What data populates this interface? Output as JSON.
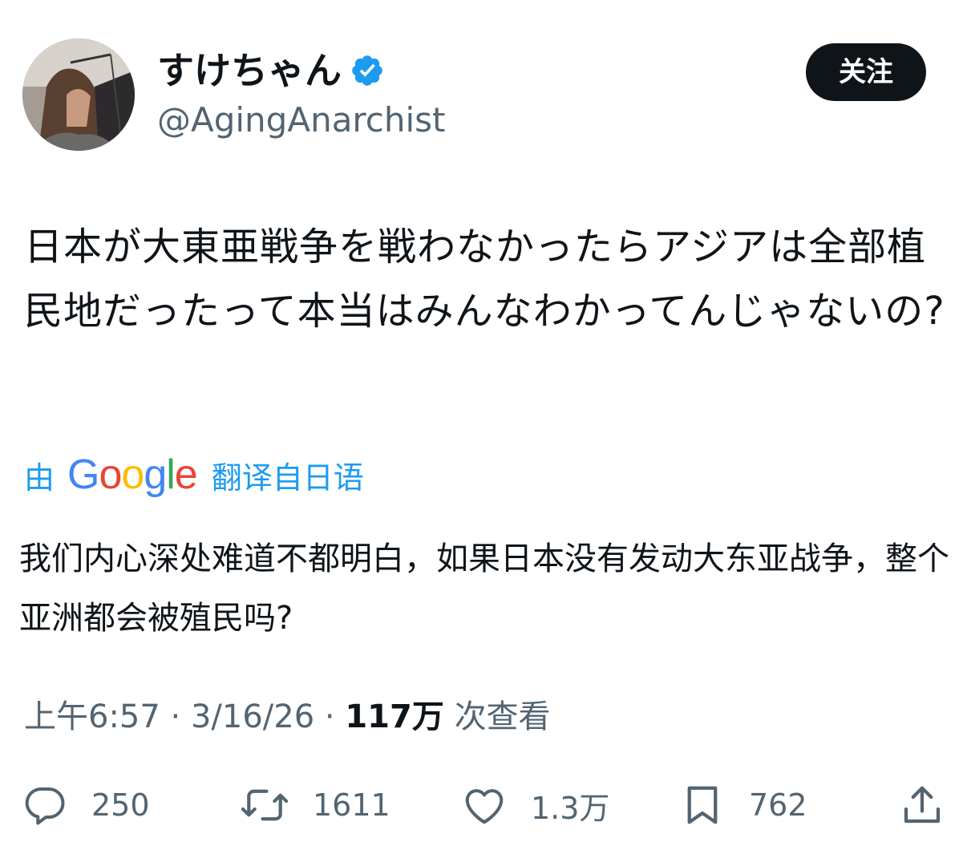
{
  "author": {
    "display_name": "すけちゃん",
    "handle": "@AgingAnarchist",
    "avatar_icon": "avatar-photo",
    "verified_icon": "verified-badge-icon",
    "verified_color": "#1d9bf0"
  },
  "follow_button": {
    "label": "关注"
  },
  "tweet": {
    "text": "日本が大東亜戦争を戦わなかったらアジアは全部植民地だったって本当はみんなわかってんじゃないの?"
  },
  "translation": {
    "prefix": "由",
    "provider": "Google",
    "suffix": "翻译自日语",
    "color": "#1d9bf0",
    "text": "我们内心深处难道不都明白，如果日本没有发动大东亚战争，整个亚洲都会被殖民吗?"
  },
  "meta": {
    "time": "上午6:57",
    "separator": "·",
    "date": "3/16/26",
    "views_count": "117万",
    "views_label": "次查看"
  },
  "actions": {
    "reply": {
      "icon": "reply-icon",
      "count": "250"
    },
    "retweet": {
      "icon": "retweet-icon",
      "count": "1611"
    },
    "like": {
      "icon": "heart-icon",
      "count": "1.3万"
    },
    "bookmark": {
      "icon": "bookmark-icon",
      "count": "762"
    },
    "share": {
      "icon": "share-icon"
    }
  }
}
